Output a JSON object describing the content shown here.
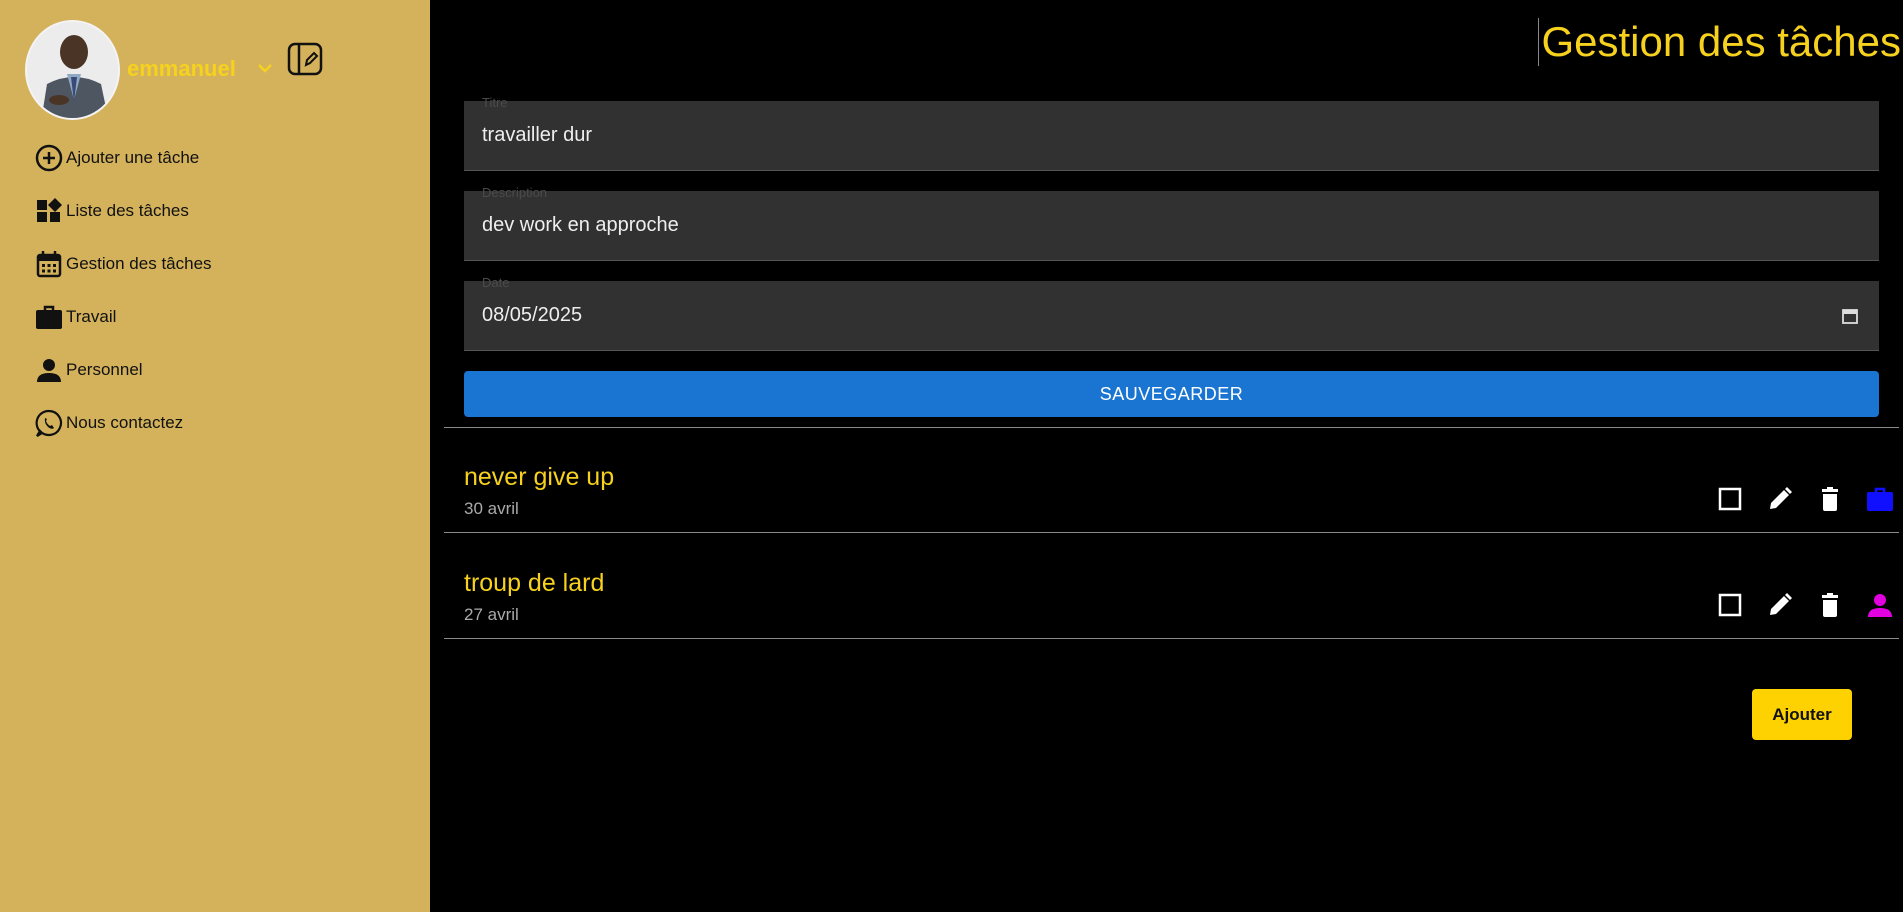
{
  "user": {
    "name": "emmanuel"
  },
  "sidebar": {
    "items": [
      {
        "label": "Ajouter une tâche",
        "icon": "add-circle-icon"
      },
      {
        "label": "Liste des tâches",
        "icon": "widgets-icon"
      },
      {
        "label": "Gestion des tâches",
        "icon": "calendar-icon"
      },
      {
        "label": "Travail",
        "icon": "briefcase-icon"
      },
      {
        "label": "Personnel",
        "icon": "person-icon"
      },
      {
        "label": "Nous contactez",
        "icon": "whatsapp-icon"
      }
    ]
  },
  "header": {
    "title": "Gestion des tâches"
  },
  "form": {
    "title": {
      "label": "Titre",
      "value": "travailler dur"
    },
    "description": {
      "label": "Description",
      "value": "dev work en approche"
    },
    "date": {
      "label": "Date",
      "value": "08/05/2025"
    },
    "save_label": "SAUVEGARDER"
  },
  "tasks": [
    {
      "title": "never give up",
      "date": "30 avril",
      "category_icon": "briefcase-icon",
      "category_color": "#1010ff"
    },
    {
      "title": "troup de lard",
      "date": "27 avril",
      "category_icon": "person-icon",
      "category_color": "#e000e0"
    }
  ],
  "add_label": "Ajouter",
  "colors": {
    "sidebar": "#d4b25c",
    "accent": "#f6d11d",
    "primary": "#1a75d2",
    "add_button": "#fdd200"
  }
}
